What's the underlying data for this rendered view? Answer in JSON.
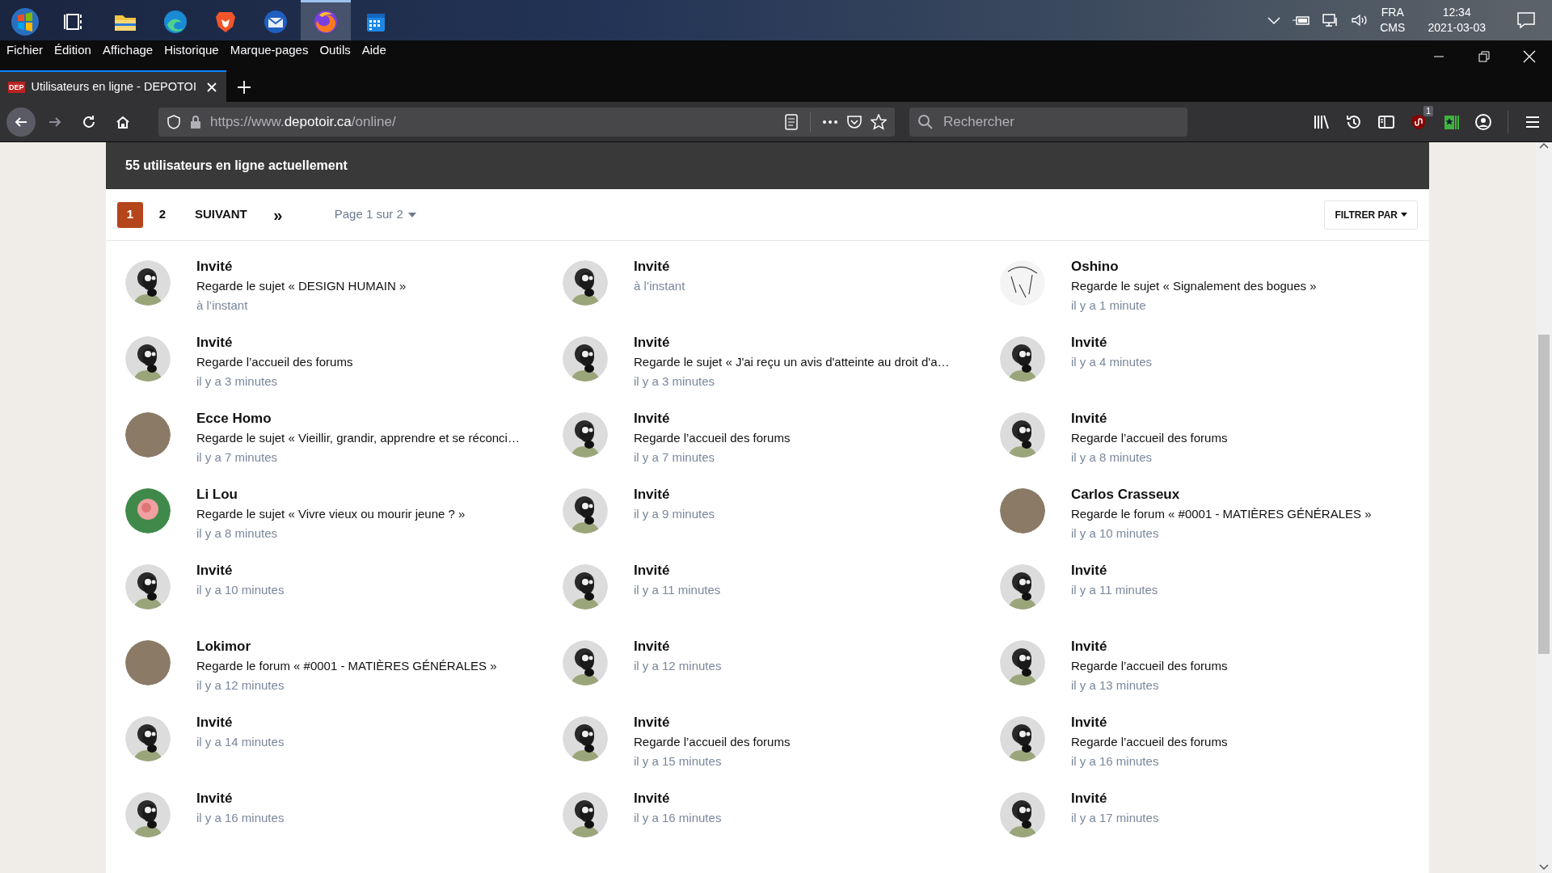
{
  "taskbar": {
    "apps": [
      {
        "kind": "start",
        "selected": false
      },
      {
        "kind": "taskview",
        "selected": false
      },
      {
        "kind": "folder",
        "selected": false
      },
      {
        "kind": "swirl",
        "selected": false
      },
      {
        "kind": "lion",
        "selected": false
      },
      {
        "kind": "mail",
        "selected": false
      },
      {
        "kind": "fox",
        "selected": true
      },
      {
        "kind": "calendar",
        "selected": false
      }
    ],
    "tray": {
      "language": "FRA",
      "layout": "CMS",
      "time": "12:34",
      "date": "2021-03-03"
    }
  },
  "menu": [
    "Fichier",
    "Édition",
    "Affichage",
    "Historique",
    "Marque-pages",
    "Outils",
    "Aide"
  ],
  "tab": {
    "favicon": "DEP",
    "title": "Utilisateurs en ligne - DEPOTOI"
  },
  "nav": [
    {
      "kind": "back",
      "disabled": false
    },
    {
      "kind": "forward",
      "disabled": true
    },
    {
      "kind": "reload",
      "disabled": false
    },
    {
      "kind": "home",
      "disabled": false
    }
  ],
  "url": {
    "prefix": "https://www.",
    "host": "depotoir.ca",
    "path": "/online/"
  },
  "search": {
    "placeholder": "Rechercher"
  },
  "extension_badge": "1",
  "header": "55 utilisateurs en ligne actuellement",
  "pagination": {
    "pages": [
      {
        "label": "1",
        "selected": true
      },
      {
        "label": "2",
        "selected": false
      }
    ],
    "next": "SUIVANT",
    "last": "»",
    "page_info": "Page 1 sur 2",
    "filter": "FILTRER PAR"
  },
  "users": [
    {
      "name": "Invité",
      "kind": "guest",
      "activity": "Regarde le sujet « DESIGN HUMAIN »",
      "time": "à l’instant"
    },
    {
      "name": "Invité",
      "kind": "guest",
      "time": "à l’instant"
    },
    {
      "name": "Oshino",
      "kind": "sketch",
      "activity": "Regarde le sujet « Signalement des bogues »",
      "time": "il y a 1 minute"
    },
    {
      "name": "Invité",
      "kind": "guest",
      "activity": "Regarde l’accueil des forums",
      "time": "il y a 3 minutes"
    },
    {
      "name": "Invité",
      "kind": "guest",
      "activity": "Regarde le sujet « J'ai reçu un avis d'atteinte au droit d'a…",
      "time": "il y a 3 minutes"
    },
    {
      "name": "Invité",
      "kind": "guest",
      "time": "il y a 4 minutes"
    },
    {
      "name": "Ecce Homo",
      "kind": "photo",
      "activity": "Regarde le sujet « Vieillir, grandir, apprendre et se réconci…",
      "time": "il y a 7 minutes"
    },
    {
      "name": "Invité",
      "kind": "guest",
      "activity": "Regarde l’accueil des forums",
      "time": "il y a 7 minutes"
    },
    {
      "name": "Invité",
      "kind": "guest",
      "activity": "Regarde l’accueil des forums",
      "time": "il y a 8 minutes"
    },
    {
      "name": "Li Lou",
      "kind": "flower",
      "activity": "Regarde le sujet « Vivre vieux ou mourir jeune ? »",
      "time": "il y a 8 minutes"
    },
    {
      "name": "Invité",
      "kind": "guest",
      "time": "il y a 9 minutes"
    },
    {
      "name": "Carlos Crasseux",
      "kind": "photo",
      "activity": "Regarde le forum « #0001 - MATIÈRES GÉNÉRALES »",
      "time": "il y a 10 minutes"
    },
    {
      "name": "Invité",
      "kind": "guest",
      "time": "il y a 10 minutes"
    },
    {
      "name": "Invité",
      "kind": "guest",
      "time": "il y a 11 minutes"
    },
    {
      "name": "Invité",
      "kind": "guest",
      "time": "il y a 11 minutes"
    },
    {
      "name": "Lokimor",
      "kind": "photo",
      "activity": "Regarde le forum « #0001 - MATIÈRES GÉNÉRALES »",
      "time": "il y a 12 minutes"
    },
    {
      "name": "Invité",
      "kind": "guest",
      "time": "il y a 12 minutes"
    },
    {
      "name": "Invité",
      "kind": "guest",
      "activity": "Regarde l’accueil des forums",
      "time": "il y a 13 minutes"
    },
    {
      "name": "Invité",
      "kind": "guest",
      "time": "il y a 14 minutes"
    },
    {
      "name": "Invité",
      "kind": "guest",
      "activity": "Regarde l’accueil des forums",
      "time": "il y a 15 minutes"
    },
    {
      "name": "Invité",
      "kind": "guest",
      "activity": "Regarde l’accueil des forums",
      "time": "il y a 16 minutes"
    },
    {
      "name": "Invité",
      "kind": "guest",
      "time": "il y a 16 minutes"
    },
    {
      "name": "Invité",
      "kind": "guest",
      "time": "il y a 16 minutes"
    },
    {
      "name": "Invité",
      "kind": "guest",
      "time": "il y a 17 minutes"
    }
  ]
}
